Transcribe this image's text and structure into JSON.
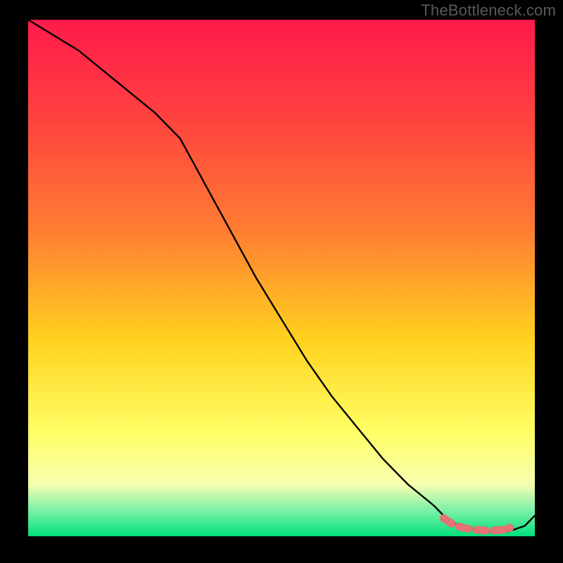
{
  "watermark": "TheBottleneck.com",
  "colors": {
    "bg_black": "#000000",
    "watermark_gray": "#5a5a5a",
    "line_black": "#000000",
    "marker_red": "#e57373",
    "gradient_top": "#ff1a4b",
    "gradient_mid_upper": "#ff7a33",
    "gradient_mid": "#ffd21f",
    "gradient_mid_lower": "#ffff66",
    "gradient_pale": "#f7ffb0",
    "gradient_mint": "#7af0a8",
    "gradient_green": "#00e07a"
  },
  "chart_data": {
    "type": "line",
    "title": "",
    "xlabel": "",
    "ylabel": "",
    "xlim": [
      0,
      100
    ],
    "ylim": [
      0,
      100
    ],
    "series": [
      {
        "name": "curve",
        "x": [
          0,
          5,
          10,
          15,
          20,
          25,
          30,
          35,
          40,
          45,
          50,
          55,
          60,
          65,
          70,
          75,
          80,
          82,
          85,
          90,
          95,
          98,
          100
        ],
        "y": [
          100,
          97,
          94,
          90,
          86,
          82,
          77,
          68,
          59,
          50,
          42,
          34,
          27,
          21,
          15,
          10,
          6,
          4,
          2,
          1,
          1,
          2,
          4
        ]
      }
    ],
    "markers": {
      "name": "highlight-points",
      "x": [
        82,
        84,
        86,
        88,
        90,
        92,
        94,
        95
      ],
      "y": [
        3.5,
        2.2,
        1.6,
        1.3,
        1.1,
        1.1,
        1.3,
        1.6
      ]
    },
    "end_marker": {
      "x": 95,
      "y": 1.6
    }
  }
}
